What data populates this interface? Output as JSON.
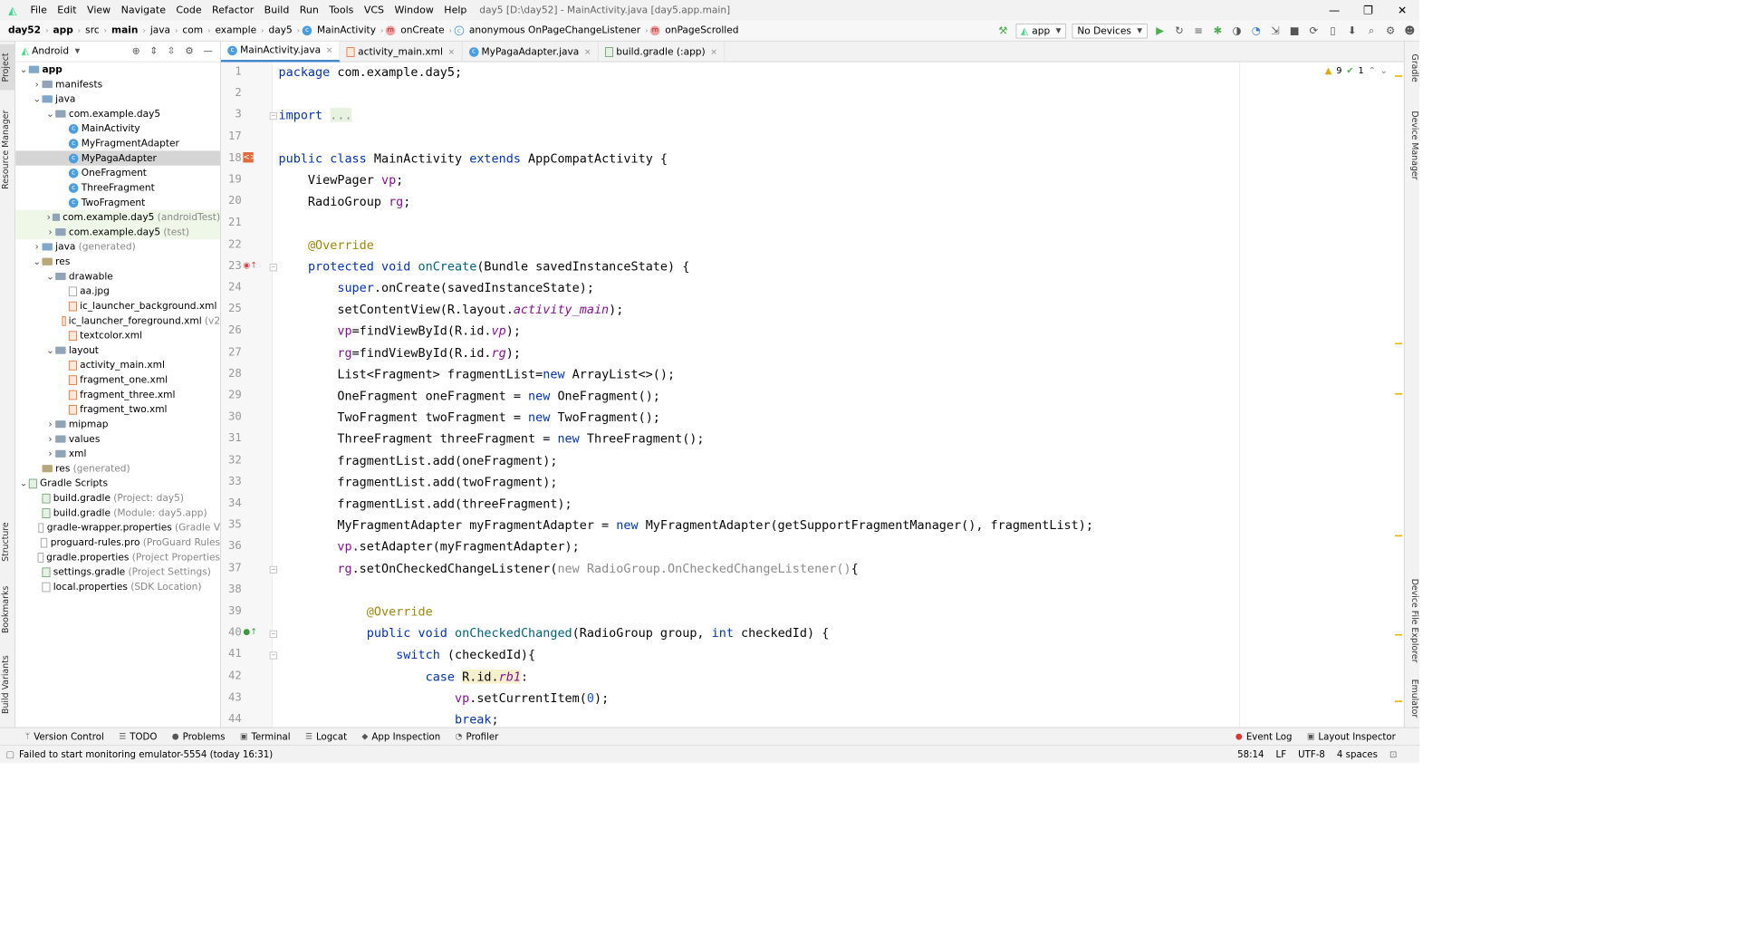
{
  "menubar": {
    "items": [
      "File",
      "Edit",
      "View",
      "Navigate",
      "Code",
      "Refactor",
      "Build",
      "Run",
      "Tools",
      "VCS",
      "Window",
      "Help"
    ],
    "title": "day5 [D:\\day52] - MainActivity.java [day5.app.main]",
    "minimize": "—",
    "restore": "❐",
    "close": "✕"
  },
  "navbar": {
    "crumbs": [
      "day52",
      "app",
      "src",
      "main",
      "java",
      "com",
      "example",
      "day5",
      "MainActivity",
      "onCreate",
      "anonymous OnPageChangeListener",
      "onPageScrolled"
    ],
    "run_config": "app",
    "device": "No Devices"
  },
  "left_tool_tabs": [
    "Project",
    "Resource Manager",
    "Structure",
    "Bookmarks",
    "Build Variants"
  ],
  "right_tool_tabs": [
    "Gradle",
    "Device Manager",
    "Device File Explorer",
    "Emulator"
  ],
  "project_panel": {
    "view_mode": "Android",
    "tree": [
      {
        "label": "app",
        "extra": "",
        "level": 0,
        "kind": "module",
        "open": true
      },
      {
        "label": "manifests",
        "extra": "",
        "level": 1,
        "kind": "folder",
        "open": false
      },
      {
        "label": "java",
        "extra": "",
        "level": 1,
        "kind": "src",
        "open": true
      },
      {
        "label": "com.example.day5",
        "extra": "",
        "level": 2,
        "kind": "folder",
        "open": true
      },
      {
        "label": "MainActivity",
        "extra": "",
        "level": 3,
        "kind": "class"
      },
      {
        "label": "MyFragmentAdapter",
        "extra": "",
        "level": 3,
        "kind": "class"
      },
      {
        "label": "MyPagaAdapter",
        "extra": "",
        "level": 3,
        "kind": "class",
        "selected": true
      },
      {
        "label": "OneFragment",
        "extra": "",
        "level": 3,
        "kind": "class"
      },
      {
        "label": "ThreeFragment",
        "extra": "",
        "level": 3,
        "kind": "class"
      },
      {
        "label": "TwoFragment",
        "extra": "",
        "level": 3,
        "kind": "class"
      },
      {
        "label": "com.example.day5",
        "extra": "(androidTest)",
        "level": 2,
        "kind": "folder",
        "open": false,
        "test": true
      },
      {
        "label": "com.example.day5",
        "extra": "(test)",
        "level": 2,
        "kind": "folder",
        "open": false,
        "test": true
      },
      {
        "label": "java",
        "extra": "(generated)",
        "level": 1,
        "kind": "src",
        "open": false
      },
      {
        "label": "res",
        "extra": "",
        "level": 1,
        "kind": "res",
        "open": true
      },
      {
        "label": "drawable",
        "extra": "",
        "level": 2,
        "kind": "folder",
        "open": true
      },
      {
        "label": "aa.jpg",
        "extra": "",
        "level": 3,
        "kind": "file"
      },
      {
        "label": "ic_launcher_background.xml",
        "extra": "",
        "level": 3,
        "kind": "xml"
      },
      {
        "label": "ic_launcher_foreground.xml",
        "extra": "(v2",
        "level": 3,
        "kind": "xml"
      },
      {
        "label": "textcolor.xml",
        "extra": "",
        "level": 3,
        "kind": "xml"
      },
      {
        "label": "layout",
        "extra": "",
        "level": 2,
        "kind": "folder",
        "open": true
      },
      {
        "label": "activity_main.xml",
        "extra": "",
        "level": 3,
        "kind": "xml"
      },
      {
        "label": "fragment_one.xml",
        "extra": "",
        "level": 3,
        "kind": "xml"
      },
      {
        "label": "fragment_three.xml",
        "extra": "",
        "level": 3,
        "kind": "xml"
      },
      {
        "label": "fragment_two.xml",
        "extra": "",
        "level": 3,
        "kind": "xml"
      },
      {
        "label": "mipmap",
        "extra": "",
        "level": 2,
        "kind": "folder",
        "open": false
      },
      {
        "label": "values",
        "extra": "",
        "level": 2,
        "kind": "folder",
        "open": false
      },
      {
        "label": "xml",
        "extra": "",
        "level": 2,
        "kind": "folder",
        "open": false
      },
      {
        "label": "res",
        "extra": "(generated)",
        "level": 1,
        "kind": "res",
        "noarrow": true
      },
      {
        "label": "Gradle Scripts",
        "extra": "",
        "level": 0,
        "kind": "gradle-root",
        "open": true
      },
      {
        "label": "build.gradle",
        "extra": "(Project: day5)",
        "level": 1,
        "kind": "gradle"
      },
      {
        "label": "build.gradle",
        "extra": "(Module: day5.app)",
        "level": 1,
        "kind": "gradle"
      },
      {
        "label": "gradle-wrapper.properties",
        "extra": "(Gradle V",
        "level": 1,
        "kind": "file"
      },
      {
        "label": "proguard-rules.pro",
        "extra": "(ProGuard Rules",
        "level": 1,
        "kind": "file"
      },
      {
        "label": "gradle.properties",
        "extra": "(Project Properties",
        "level": 1,
        "kind": "file"
      },
      {
        "label": "settings.gradle",
        "extra": "(Project Settings)",
        "level": 1,
        "kind": "gradle"
      },
      {
        "label": "local.properties",
        "extra": "(SDK Location)",
        "level": 1,
        "kind": "file"
      }
    ]
  },
  "editor_tabs": [
    {
      "label": "MainActivity.java",
      "active": true,
      "icon": "java"
    },
    {
      "label": "activity_main.xml",
      "active": false,
      "icon": "xml"
    },
    {
      "label": "MyPagaAdapter.java",
      "active": false,
      "icon": "java"
    },
    {
      "label": "build.gradle (:app)",
      "active": false,
      "icon": "gradle"
    }
  ],
  "inspection": {
    "warnings": "9",
    "weak_warnings": "1"
  },
  "code_lines": [
    {
      "n": "1",
      "html": "<span class=\"kw\">package</span> com.example.day5;"
    },
    {
      "n": "2",
      "html": ""
    },
    {
      "n": "3",
      "html": "<span class=\"kw\">import</span> <span class=\"gr\" style=\"background:#e8f2e0\">...</span>"
    },
    {
      "n": "17",
      "html": ""
    },
    {
      "n": "18",
      "html": "<span class=\"kw\">public class</span> MainActivity <span class=\"kw\">extends</span> AppCompatActivity {"
    },
    {
      "n": "19",
      "html": "    ViewPager <span class=\"fd\">vp</span>;"
    },
    {
      "n": "20",
      "html": "    RadioGroup <span class=\"fd\">rg</span>;"
    },
    {
      "n": "21",
      "html": ""
    },
    {
      "n": "22",
      "html": "    <span class=\"an\">@Override</span>"
    },
    {
      "n": "23",
      "html": "    <span class=\"kw\">protected void</span> <span style=\"color:#00627a\">onCreate</span>(Bundle savedInstanceState) {"
    },
    {
      "n": "24",
      "html": "        <span class=\"kw\">super</span>.onCreate(savedInstanceState);"
    },
    {
      "n": "25",
      "html": "        setContentView(R.layout.<span class=\"fd it\">activity_main</span>);"
    },
    {
      "n": "26",
      "html": "        <span class=\"fd\">vp</span>=findViewById(R.id.<span class=\"fd it\">vp</span>);"
    },
    {
      "n": "27",
      "html": "        <span class=\"fd\">rg</span>=findViewById(R.id.<span class=\"fd it\">rg</span>);"
    },
    {
      "n": "28",
      "html": "        List&lt;Fragment&gt; fragmentList=<span class=\"kw\">new</span> ArrayList&lt;&gt;();"
    },
    {
      "n": "29",
      "html": "        OneFragment oneFragment = <span class=\"kw\">new</span> OneFragment();"
    },
    {
      "n": "30",
      "html": "        TwoFragment twoFragment = <span class=\"kw\">new</span> TwoFragment();"
    },
    {
      "n": "31",
      "html": "        ThreeFragment threeFragment = <span class=\"kw\">new</span> ThreeFragment();"
    },
    {
      "n": "32",
      "html": "        fragmentList.add(oneFragment);"
    },
    {
      "n": "33",
      "html": "        fragmentList.add(twoFragment);"
    },
    {
      "n": "34",
      "html": "        fragmentList.add(threeFragment);"
    },
    {
      "n": "35",
      "html": "        MyFragmentAdapter myFragmentAdapter = <span class=\"kw\">new</span> MyFragmentAdapter(getSupportFragmentManager(), fragmentList);"
    },
    {
      "n": "36",
      "html": "        <span class=\"fd\">vp</span>.setAdapter(myFragmentAdapter);"
    },
    {
      "n": "37",
      "html": "        <span class=\"fd\">rg</span>.setOnCheckedChangeListener(<span class=\"gr\"><span class=\"kw\" style=\"color:#8c8c8c\">new</span> RadioGroup.OnCheckedChangeListener()</span>{"
    },
    {
      "n": "38",
      "html": ""
    },
    {
      "n": "39",
      "html": "            <span class=\"an\">@Override</span>"
    },
    {
      "n": "40",
      "html": "            <span class=\"kw\">public void</span> <span style=\"color:#00627a\">onCheckedChanged</span>(RadioGroup group, <span class=\"kw\">int</span> checkedId) {"
    },
    {
      "n": "41",
      "html": "                <span class=\"kw\">switch</span> (checkedId){"
    },
    {
      "n": "42",
      "html": "                    <span class=\"kw\">case</span> <span class=\"hl\">R.id.<span class=\"fd it\">rb1</span></span>:"
    },
    {
      "n": "43",
      "html": "                        <span class=\"fd\">vp</span>.setCurrentItem(<span class=\"num\">0</span>);"
    },
    {
      "n": "44",
      "html": "                        <span class=\"kw\">break</span>;"
    }
  ],
  "bottom_tabs": [
    {
      "label": "Version Control",
      "icon": "ᛘ"
    },
    {
      "label": "TODO",
      "icon": "☰"
    },
    {
      "label": "Problems",
      "icon": "●"
    },
    {
      "label": "Terminal",
      "icon": "▣"
    },
    {
      "label": "Logcat",
      "icon": "☰"
    },
    {
      "label": "App Inspection",
      "icon": "◆"
    },
    {
      "label": "Profiler",
      "icon": "◔"
    }
  ],
  "bottom_right_tabs": [
    {
      "label": "Event Log",
      "icon": "●"
    },
    {
      "label": "Layout Inspector",
      "icon": "▣"
    }
  ],
  "statusbar": {
    "message": "Failed to start monitoring emulator-5554 (today 16:31)",
    "position": "58:14",
    "line_sep": "LF",
    "encoding": "UTF-8",
    "indent": "4 spaces"
  },
  "colors": {
    "keyword": "#0033b3",
    "annotation": "#9e880d",
    "field": "#871094",
    "accent": "#4083c9"
  }
}
